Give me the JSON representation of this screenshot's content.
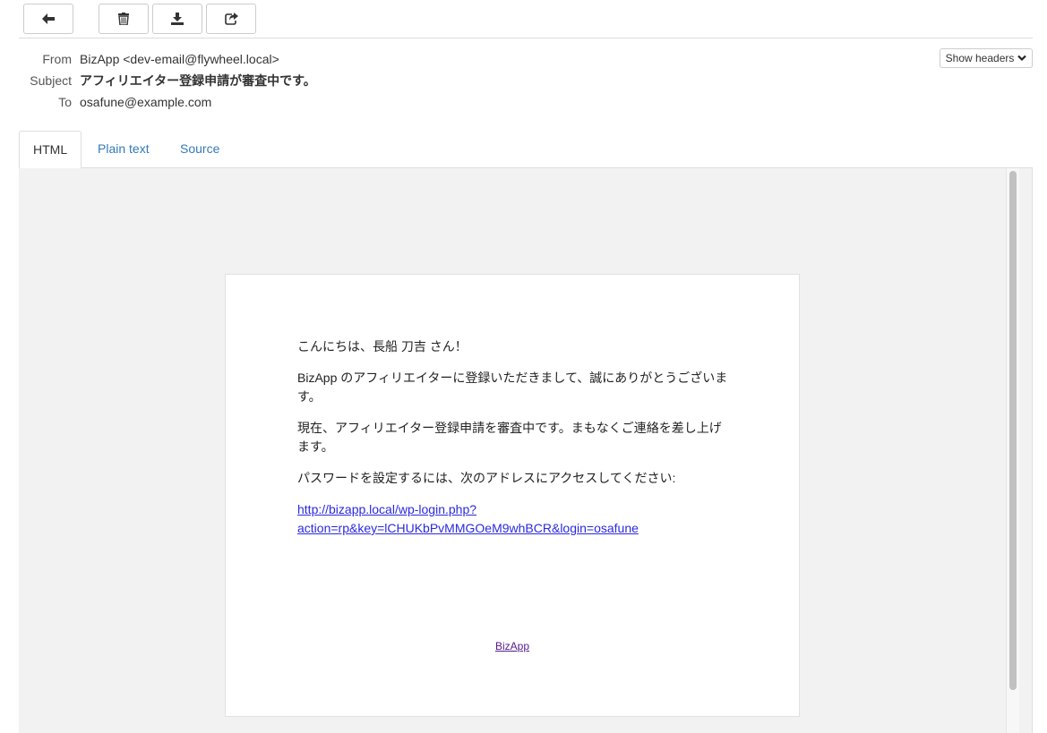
{
  "toolbar": {
    "buttons": [
      {
        "name": "back",
        "icon": "arrow-left-icon"
      },
      {
        "name": "delete",
        "icon": "trash-icon"
      },
      {
        "name": "download",
        "icon": "download-icon"
      },
      {
        "name": "forward",
        "icon": "share-icon"
      }
    ]
  },
  "headers": {
    "from_label": "From",
    "from_value": "BizApp <dev-email@flywheel.local>",
    "subject_label": "Subject",
    "subject_value": "アフィリエイター登録申請が審査中です。",
    "to_label": "To",
    "to_value": "osafune@example.com",
    "show_headers_label": "Show headers",
    "show_headers_icon": "chevron-down-icon"
  },
  "tabs": [
    {
      "label": "HTML",
      "active": true
    },
    {
      "label": "Plain text",
      "active": false
    },
    {
      "label": "Source",
      "active": false
    }
  ],
  "email": {
    "greeting": "こんにちは、長船 刀吉 さん！",
    "paragraph1": "BizApp のアフィリエイターに登録いただきまして、誠にありがとうございます。",
    "paragraph2": "現在、アフィリエイター登録申請を審査中です。まもなくご連絡を差し上げます。",
    "paragraph3": "パスワードを設定するには、次のアドレスにアクセスしてください:",
    "link_line1": "http://bizapp.local/wp-login.php?",
    "link_line2": "action=rp&key=lCHUKbPvMMGOeM9whBCR&login=osafune",
    "footer_link": "BizApp"
  },
  "colors": {
    "link": "#2a2ae0",
    "tab_link": "#337ab7",
    "preview_bg": "#f2f2f2"
  }
}
